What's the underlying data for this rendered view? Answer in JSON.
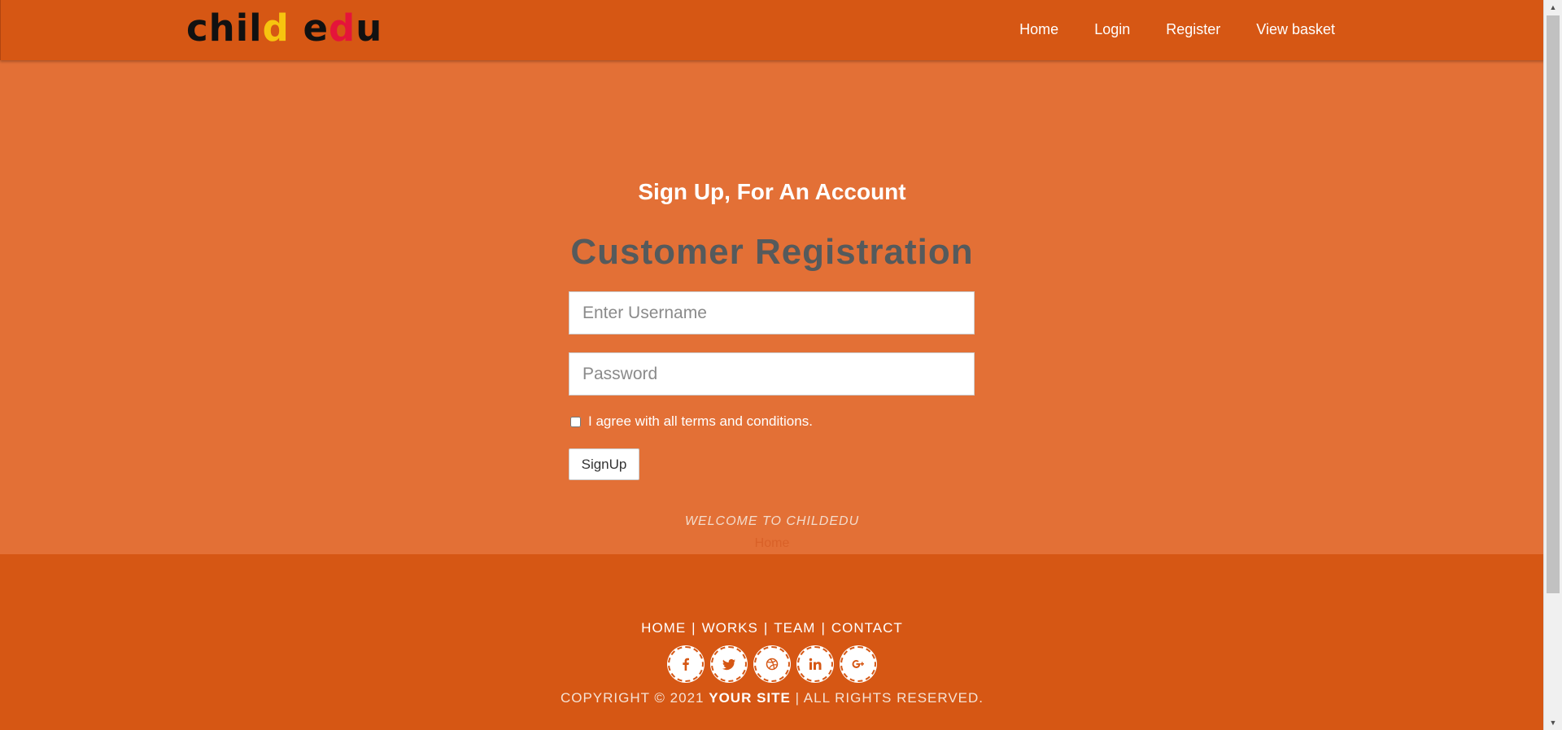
{
  "header": {
    "logo": {
      "part1": "chil",
      "part2": "d",
      "space": " ",
      "part3": "e",
      "part4": "d",
      "part5": "u"
    },
    "nav": [
      "Home",
      "Login",
      "Register",
      "View basket"
    ]
  },
  "form": {
    "subtitle": "Sign Up, For An Account",
    "title": "Customer Registration",
    "username_placeholder": "Enter Username",
    "password_placeholder": "Password",
    "terms_label": "I agree with all terms and conditions.",
    "submit_label": "SignUp"
  },
  "banner": {
    "welcome": "WELCOME TO CHILDEDU",
    "breadcrumb": "Home"
  },
  "footer": {
    "links": [
      "HOME",
      "WORKS",
      "TEAM",
      "CONTACT"
    ],
    "separator": "|",
    "socials": [
      "facebook-icon",
      "twitter-icon",
      "dribbble-icon",
      "linkedin-icon",
      "google-plus-icon"
    ],
    "copyright_prefix": "COPYRIGHT © 2021",
    "copyright_site": "YOUR SITE",
    "copyright_suffix": "| ALL RIGHTS RESERVED."
  },
  "colors": {
    "header_bg": "#d65714",
    "page_bg": "#e37036",
    "title_color": "#555a5c",
    "logo_yellow": "#f7c40f",
    "logo_blue": "#1f44d4",
    "logo_red": "#e5143a"
  }
}
